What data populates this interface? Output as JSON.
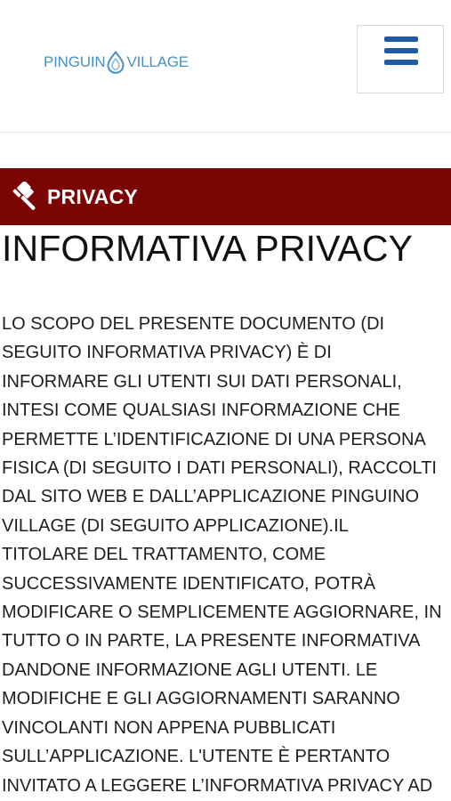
{
  "header": {
    "logo": {
      "left_text": "PINGUIN",
      "right_text": "VILLAGE"
    },
    "menu_icon": "hamburger-menu-icon",
    "menu_color": "#1f5aa5"
  },
  "section_banner": {
    "icon": "gavel-icon",
    "label": "PRIVACY",
    "background_color": "#7b0404"
  },
  "page_title": "INFORMATIVA PRIVACY",
  "body_lines": [
    "LO SCOPO DEL PRESENTE DOCUMENTO (DI",
    "SEGUITO INFORMATIVA PRIVACY) È DI",
    "INFORMARE GLI UTENTI SUI DATI PERSONALI,",
    "INTESI COME QUALSIASI INFORMAZIONE CHE",
    "PERMETTE L’IDENTIFICAZIONE DI UNA PERSONA",
    "FISICA (DI SEGUITO I DATI PERSONALI), RACCOLTI",
    "DAL SITO WEB E DALL’APPLICAZIONE PINGUINO",
    "VILLAGE (DI SEGUITO APPLICAZIONE).IL",
    "TITOLARE DEL TRATTAMENTO, COME",
    "SUCCESSIVAMENTE IDENTIFICATO, POTRÀ",
    "MODIFICARE O SEMPLICEMENTE AGGIORNARE, IN",
    "TUTTO O IN PARTE, LA PRESENTE INFORMATIVA",
    "DANDONE INFORMAZIONE AGLI UTENTI. LE",
    "MODIFICHE E GLI AGGIORNAMENTI SARANNO",
    "VINCOLANTI NON APPENA PUBBLICATI",
    "SULL’APPLICAZIONE. L'UTENTE È PERTANTO",
    "INVITATO A LEGGERE L’INFORMATIVA PRIVACY AD"
  ]
}
